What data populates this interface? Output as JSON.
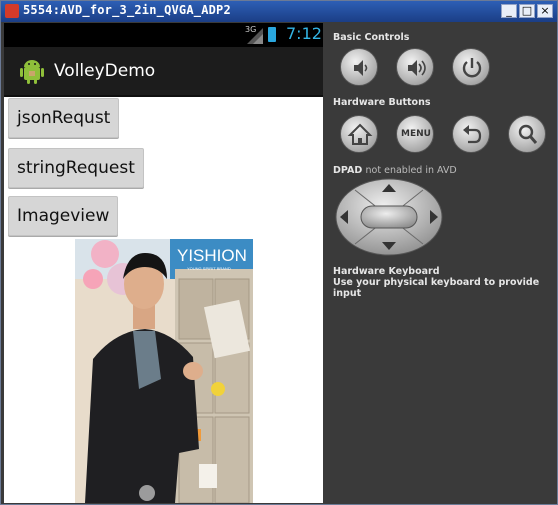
{
  "window": {
    "title": "5554:AVD_for_3_2in_QVGA_ADP2",
    "minimize_label": "_",
    "maximize_label": "□",
    "close_label": "×"
  },
  "statusbar": {
    "signal_label": "3G",
    "time": "7:12"
  },
  "app": {
    "title": "VolleyDemo",
    "buttons": [
      "jsonRequst",
      "stringRequest",
      "Imageview"
    ]
  },
  "image": {
    "caption": "YISHION",
    "subcaption": "YOUNG SPIRIT BRAND"
  },
  "controls": {
    "basic_controls_label": "Basic Controls",
    "hardware_buttons_label": "Hardware Buttons",
    "menu_label": "MENU",
    "dpad_label": "DPAD",
    "dpad_note": "not enabled in AVD",
    "keyboard_label": "Hardware Keyboard",
    "keyboard_hint": "Use your physical keyboard to provide input"
  },
  "colors": {
    "accent": "#33b5e5",
    "panel_bg": "#3a3a3a",
    "titlebar": "#1b3e86"
  }
}
